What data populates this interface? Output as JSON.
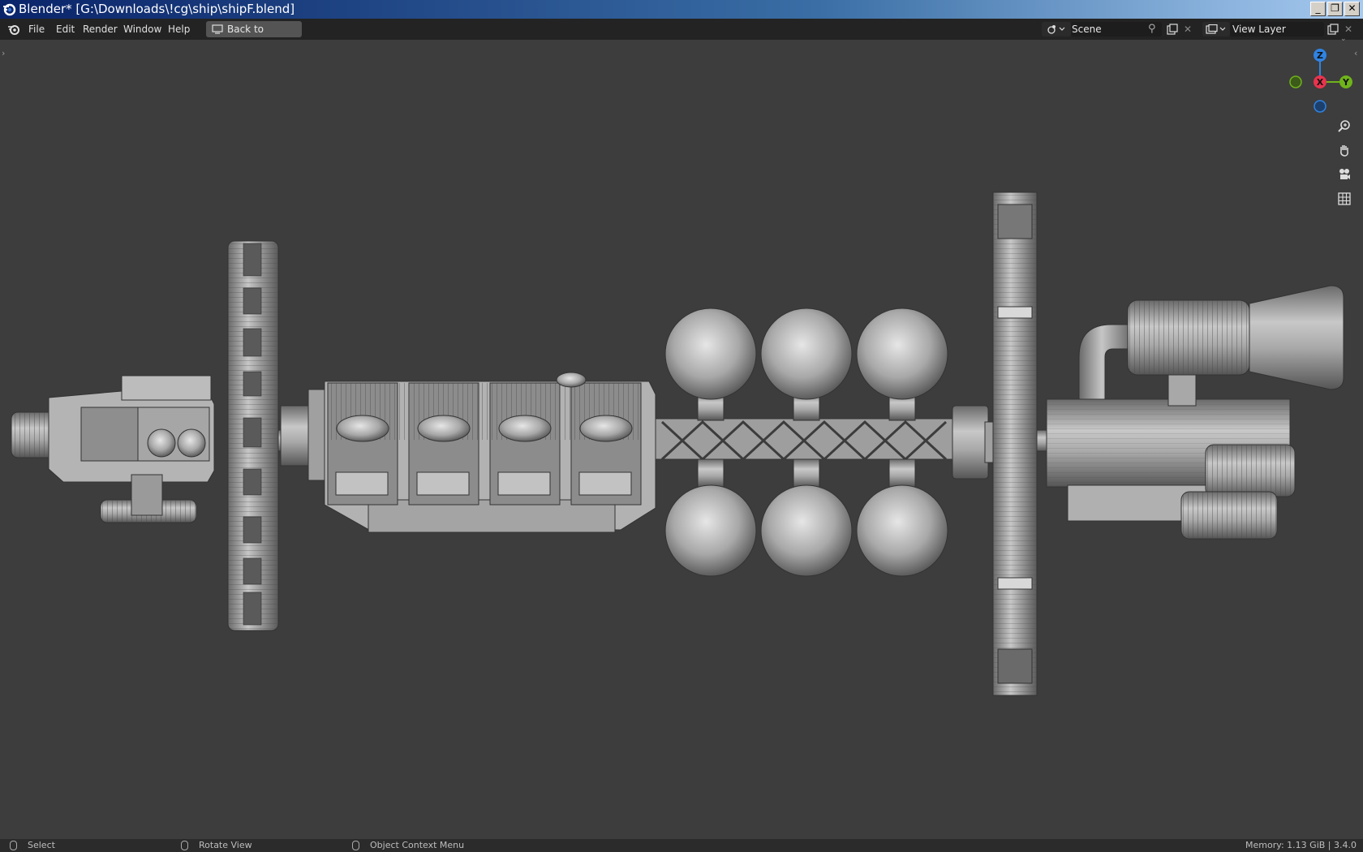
{
  "window": {
    "title": "Blender* [G:\\Downloads\\!cg\\ship\\shipF.blend]",
    "controls": {
      "minimize": "_",
      "restore": "❐",
      "close": "✕"
    }
  },
  "menu": {
    "items": [
      "File",
      "Edit",
      "Render",
      "Window",
      "Help"
    ],
    "back_button": "Back to Previous"
  },
  "scene": {
    "label": "Scene"
  },
  "view_layer": {
    "label": "View Layer"
  },
  "navigation_gizmo": {
    "z": "Z",
    "x": "X",
    "y": "Y"
  },
  "status": {
    "select": "Select",
    "rotate": "Rotate View",
    "context": "Object Context Menu",
    "memory": "Memory: 1.13 GiB | 3.4.0"
  },
  "colors": {
    "viewport": "#3d3d3d",
    "header": "#232323",
    "axis_x": "#e8344e",
    "axis_y": "#6fb31a",
    "axis_z": "#2f83e3",
    "model": "#a8a8a8"
  }
}
